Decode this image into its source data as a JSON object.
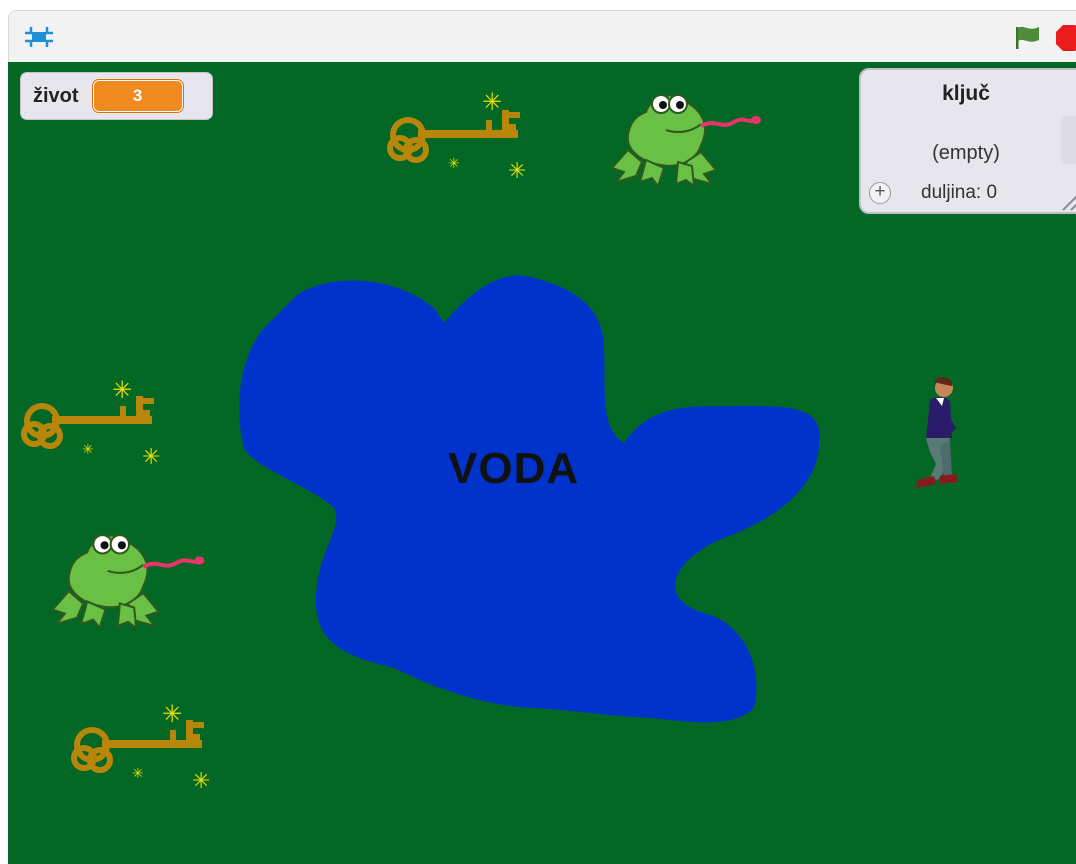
{
  "toolbar": {
    "fullscreen_icon": "fullscreen-icon",
    "flag_icon": "green-flag-icon",
    "stop_icon": "stop-icon",
    "colors": {
      "flag": "#4d8c3a",
      "stop": "#ec1b1b"
    }
  },
  "stage": {
    "background_color": "#036726",
    "pond_color": "#0033cc",
    "pond_label": "VODA"
  },
  "variable_monitor": {
    "label": "život",
    "value": "3",
    "value_color": "#f08a1f"
  },
  "list_monitor": {
    "title": "ključ",
    "empty_text": "(empty)",
    "length_text": "duljina: 0",
    "add_symbol": "+"
  },
  "sprites": {
    "keys": [
      "key",
      "key",
      "key"
    ],
    "frogs": [
      "frog",
      "frog"
    ],
    "player": "walking-boy"
  }
}
